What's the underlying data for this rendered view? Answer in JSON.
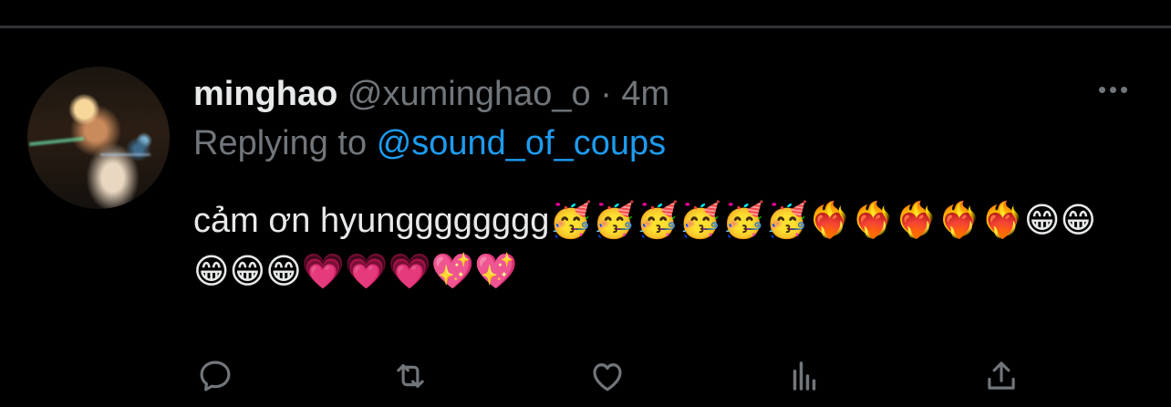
{
  "tweet": {
    "author_name": "minghao",
    "author_handle": "@xuminghao_o",
    "separator": "·",
    "time": "4m",
    "reply_prefix": "Replying to",
    "reply_mention": "@sound_of_coups",
    "text": "cảm ơn hyungggggggg🥳🥳🥳🥳🥳🥳❤️‍🔥❤️‍🔥❤️‍🔥❤️‍🔥❤️‍🔥😁😁😁😁😁💗💗💗💖💖"
  },
  "icons": {
    "more": "more-horizontal-icon",
    "reply": "reply-icon",
    "retweet": "retweet-icon",
    "like": "like-icon",
    "views": "views-icon",
    "share": "share-icon"
  },
  "colors": {
    "background": "#000000",
    "primary_text": "#e7e9ea",
    "secondary_text": "#71767b",
    "accent": "#1d9bf0",
    "divider": "#2f3336"
  }
}
